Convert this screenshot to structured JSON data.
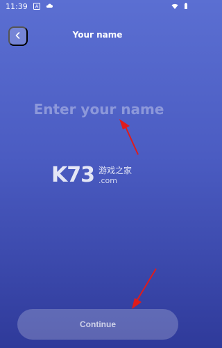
{
  "status_bar": {
    "time": "11:39",
    "icons": [
      "a-icon",
      "cloud-icon",
      "wifi-icon",
      "battery-icon"
    ]
  },
  "header": {
    "title": "Your name",
    "back_icon": "chevron-left-icon"
  },
  "name_input": {
    "placeholder": "Enter your name",
    "value": ""
  },
  "watermark": {
    "logo": "K73",
    "text": "游戏之家",
    "subtext": ".com"
  },
  "footer": {
    "continue_label": "Continue"
  },
  "colors": {
    "gradient_top": "#5b6fd2",
    "gradient_bottom": "#2f3a9a",
    "annotation_arrow": "#e01b1b"
  }
}
